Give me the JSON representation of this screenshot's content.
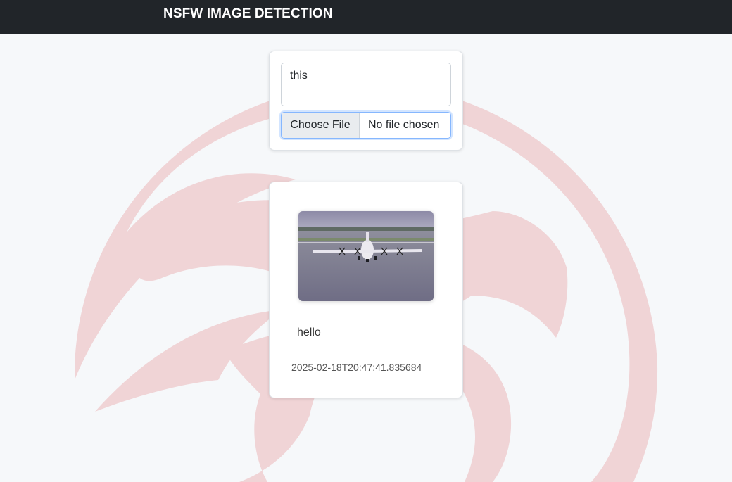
{
  "navbar": {
    "brand": "NSFW IMAGE DETECTION"
  },
  "upload_form": {
    "caption_value": "this",
    "file_button_label": "Choose File",
    "file_status": "No file chosen"
  },
  "posts": [
    {
      "image_subject": "airplane-on-runway",
      "caption": "hello",
      "timestamp": "2025-02-18T20:47:41.835684"
    }
  ],
  "colors": {
    "navbar_bg": "#212529",
    "page_bg": "#f6f8fa",
    "watermark": "#f0d4d6",
    "focus_border": "#86b7fe"
  }
}
